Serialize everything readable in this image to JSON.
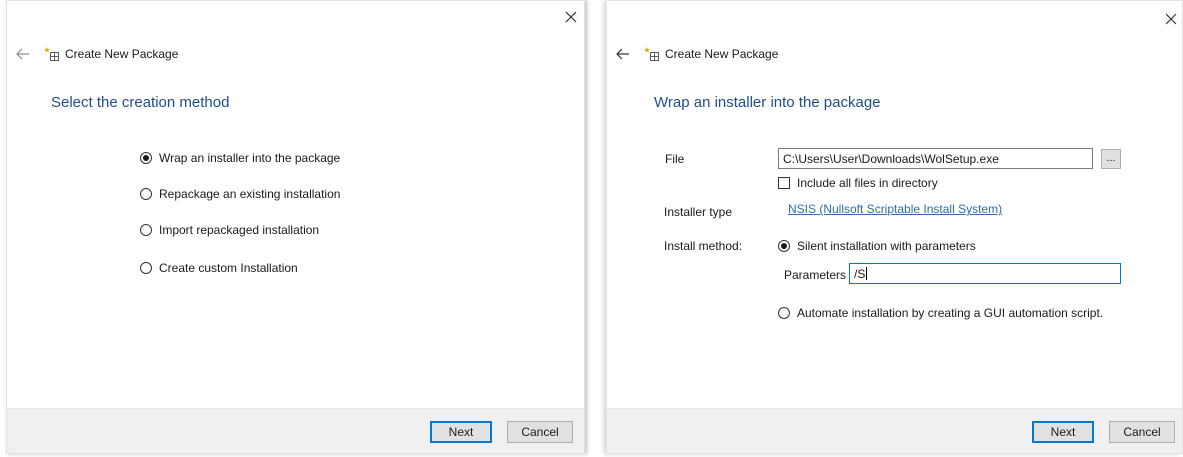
{
  "dialog1": {
    "header_title": "Create New Package",
    "section_title": "Select the creation method",
    "options": [
      {
        "label": "Wrap an installer into the package",
        "selected": true
      },
      {
        "label": "Repackage an existing installation",
        "selected": false
      },
      {
        "label": "Import repackaged installation",
        "selected": false
      },
      {
        "label": "Create custom Installation",
        "selected": false
      }
    ],
    "next_label": "Next",
    "cancel_label": "Cancel"
  },
  "dialog2": {
    "header_title": "Create New Package",
    "section_title": "Wrap an installer into the package",
    "file_label": "File",
    "file_value": "C:\\Users\\User\\Downloads\\WolSetup.exe",
    "browse_label": "...",
    "include_all_label": "Include all files in directory",
    "include_all_checked": false,
    "installer_type_label": "Installer type",
    "installer_type_value": "NSIS (Nullsoft Scriptable Install System)",
    "install_method_label": "Install method:",
    "silent_label": "Silent installation with parameters",
    "silent_selected": true,
    "parameters_label": "Parameters",
    "parameters_value": "/S",
    "automate_label": "Automate installation by creating a GUI automation script.",
    "automate_selected": false,
    "next_label": "Next",
    "cancel_label": "Cancel"
  },
  "icons": {
    "close": "close-icon",
    "back": "back-arrow-icon",
    "package": "package-icon"
  },
  "colors": {
    "title_blue": "#1f4e8c",
    "link_blue": "#2b6cb5",
    "focus_blue": "#0078d7",
    "footer_gray": "#f0f0f0"
  }
}
